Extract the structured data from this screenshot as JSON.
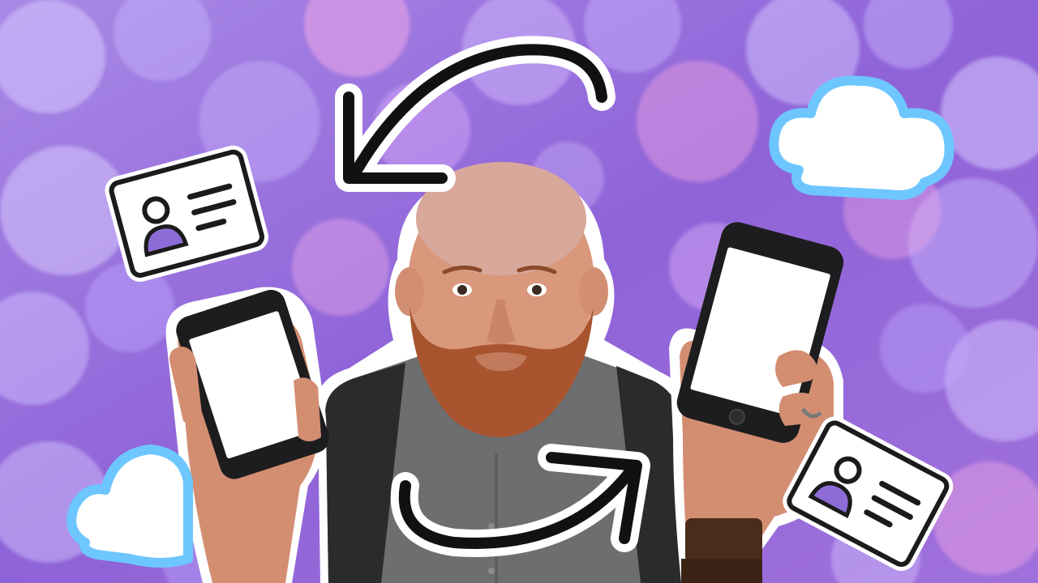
{
  "scene": {
    "description_colors": {
      "background_base": "#9b6fdc",
      "bokeh_light": "#d9c6ff",
      "bokeh_pink": "#f3a6e6",
      "sticker_outline": "#ffffff",
      "arrow_color": "#111111",
      "cloud_fill": "#ffffff",
      "cloud_stroke": "#6ec6ff",
      "card_stroke": "#1b1b1b",
      "card_accent": "#8e6cd8",
      "shirt": "#6d6e70",
      "sleeve": "#2b2b2d",
      "skin": "#d9987c",
      "beard": "#a8542f",
      "phone_body": "#1d1d1f",
      "phone_screen": "#ffffff"
    },
    "icons": [
      "curved-arrow-left-icon",
      "curved-arrow-right-icon",
      "cloud-icon",
      "contact-card-icon",
      "smartphone-icon"
    ]
  }
}
